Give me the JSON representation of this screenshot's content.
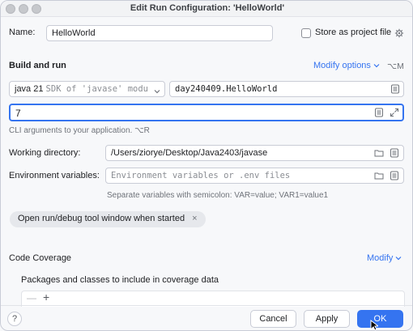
{
  "window": {
    "title": "Edit Run Configuration: 'HelloWorld'"
  },
  "name": {
    "label": "Name:",
    "value": "HelloWorld"
  },
  "store_project_file": {
    "label": "Store as project file"
  },
  "build_run": {
    "heading": "Build and run",
    "modify_options_label": "Modify options",
    "modify_options_shortcut": "⌥M",
    "jdk_version": "java 21",
    "jdk_detail": "SDK of 'javase' modu",
    "main_class": "day240409.HelloWorld",
    "program_args": "7",
    "args_hint": "CLI arguments to your application. ⌥R"
  },
  "working_directory": {
    "label": "Working directory:",
    "value": "/Users/ziorye/Desktop/Java2403/javase"
  },
  "env_vars": {
    "label": "Environment variables:",
    "placeholder": "Environment variables or .env files",
    "hint": "Separate variables with semicolon: VAR=value; VAR1=value1"
  },
  "option_chip": {
    "label": "Open run/debug tool window when started",
    "close_glyph": "×"
  },
  "code_coverage": {
    "heading": "Code Coverage",
    "modify_label": "Modify",
    "packages_label": "Packages and classes to include in coverage data",
    "remove_glyph": "—",
    "add_glyph": "+"
  },
  "footer": {
    "help_glyph": "?",
    "cancel": "Cancel",
    "apply": "Apply",
    "ok": "OK"
  },
  "colors": {
    "accent": "#3574f0",
    "background": "#f7f8fa",
    "field_border": "#c9ccd6"
  }
}
